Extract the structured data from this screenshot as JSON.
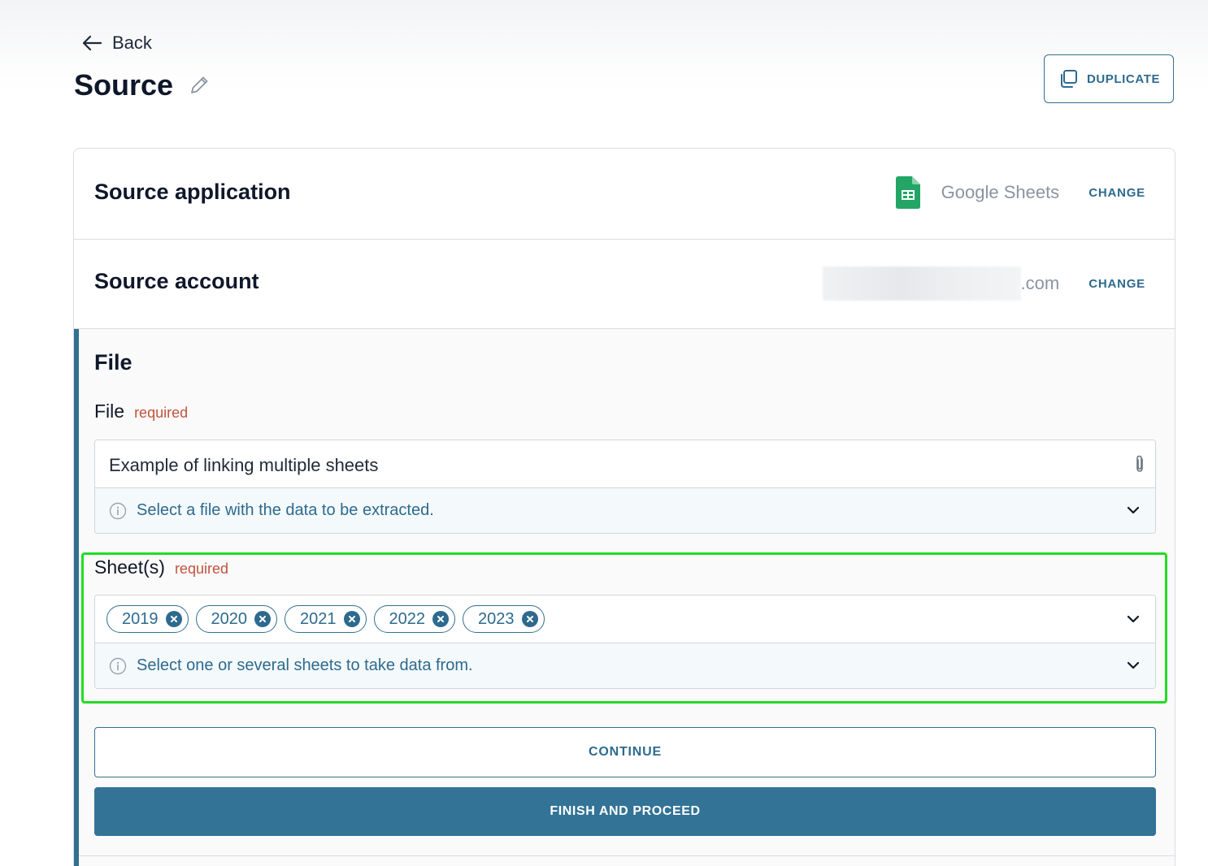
{
  "header": {
    "back_label": "Back",
    "title": "Source",
    "duplicate_label": "DUPLICATE"
  },
  "source_application": {
    "title": "Source application",
    "app_name": "Google Sheets",
    "app_icon": "google-sheets-icon",
    "change_label": "CHANGE"
  },
  "source_account": {
    "title": "Source account",
    "email_visible_suffix": ".com",
    "change_label": "CHANGE"
  },
  "file_section": {
    "title": "File",
    "file_field": {
      "label": "File",
      "required_label": "required",
      "value": "Example of linking multiple sheets",
      "hint": "Select a file with the data to be extracted."
    },
    "sheets_field": {
      "label": "Sheet(s)",
      "required_label": "required",
      "selected": [
        "2019",
        "2020",
        "2021",
        "2022",
        "2023"
      ],
      "hint": "Select one or several sheets to take data from."
    },
    "continue_label": "CONTINUE",
    "finish_label": "FINISH AND PROCEED"
  },
  "colors": {
    "accent": "#2d6a8e",
    "primary_button": "#337396",
    "required": "#c0533d",
    "highlight": "#22dd22",
    "sheets_green": "#23a566"
  }
}
